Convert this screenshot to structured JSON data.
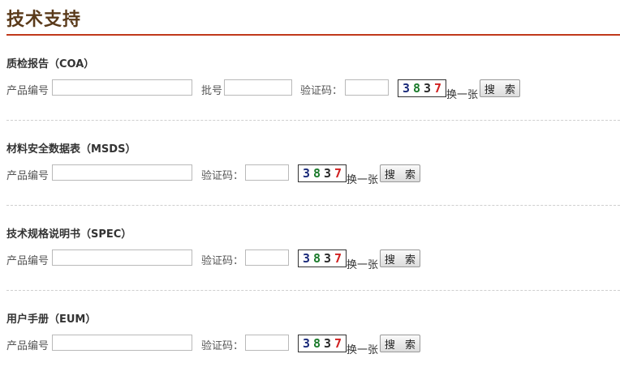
{
  "page": {
    "title": "技术支持"
  },
  "sections": [
    {
      "title": "质检报告（COA）",
      "product_label": "产品编号",
      "batch_label": "批号",
      "code_label": "验证码：",
      "captcha": [
        "3",
        "8",
        "3",
        "7"
      ],
      "swap_label": "换一张",
      "search_label": "搜 索"
    },
    {
      "title": "材料安全数据表（MSDS）",
      "product_label": "产品编号",
      "code_label": "验证码：",
      "captcha": [
        "3",
        "8",
        "3",
        "7"
      ],
      "swap_label": "换一张",
      "search_label": "搜 索"
    },
    {
      "title": "技术规格说明书（SPEC）",
      "product_label": "产品编号",
      "code_label": "验证码：",
      "captcha": [
        "3",
        "8",
        "3",
        "7"
      ],
      "swap_label": "换一张",
      "search_label": "搜 索"
    },
    {
      "title": "用户手册（EUM）",
      "product_label": "产品编号",
      "code_label": "验证码：",
      "captcha": [
        "3",
        "8",
        "3",
        "7"
      ],
      "swap_label": "换一张",
      "search_label": "搜 索"
    }
  ]
}
